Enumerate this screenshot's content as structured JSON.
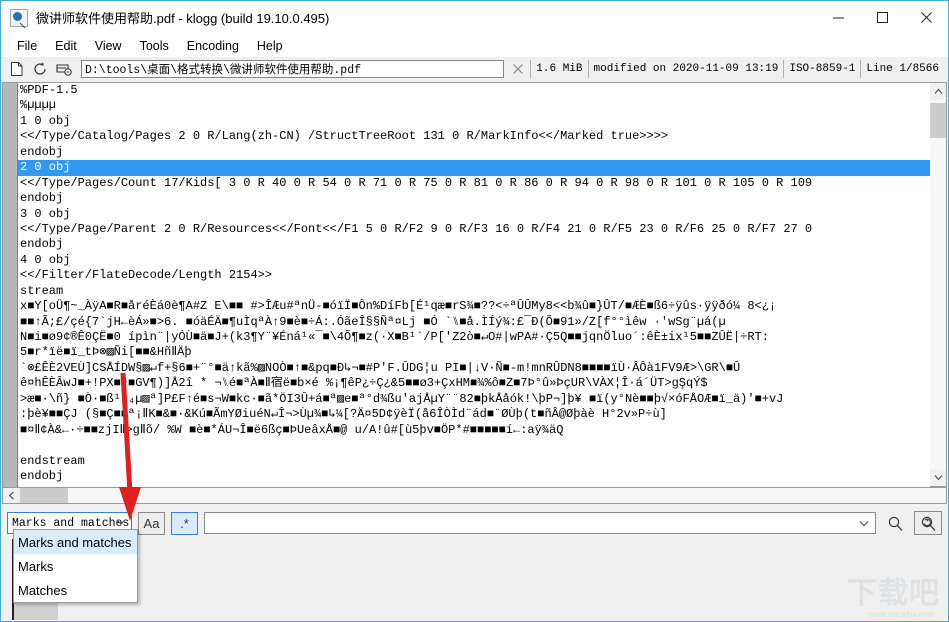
{
  "window": {
    "title": "微讲师软件使用帮助.pdf - klogg (build 19.10.0.495)",
    "icon": "klogg-app-icon",
    "minimize": "—",
    "maximize": "□",
    "close": "✕"
  },
  "menubar": {
    "items": [
      {
        "label": "File"
      },
      {
        "label": "Edit"
      },
      {
        "label": "View"
      },
      {
        "label": "Tools"
      },
      {
        "label": "Encoding"
      },
      {
        "label": "Help"
      }
    ]
  },
  "toolbar": {
    "icons": [
      {
        "name": "open-file-icon",
        "glyph": "document"
      },
      {
        "name": "reload-icon",
        "glyph": "refresh"
      },
      {
        "name": "follow-file-icon",
        "glyph": "follow"
      }
    ],
    "path": "D:\\tools\\桌面\\格式转换\\微讲师软件使用帮助.pdf",
    "close_icon": "✕",
    "status": [
      "1.6 MiB",
      "modified on 2020-11-09 13:19",
      "ISO-8859-1",
      "Line 1/8566"
    ]
  },
  "log": {
    "selected_index": 5,
    "lines": [
      "%PDF-1.5",
      "%µµµµ",
      "1 0 obj",
      "<</Type/Catalog/Pages 2 0 R/Lang(zh-CN) /StructTreeRoot 131 0 R/MarkInfo<</Marked true>>>>",
      "endobj",
      "2 0 obj",
      "<</Type/Pages/Count 17/Kids[ 3 0 R 40 0 R 54 0 R 71 0 R 75 0 R 81 0 R 86 0 R 94 0 R 98 0 R 101 0 R 105 0 R 109",
      "endobj",
      "3 0 obj",
      "<</Type/Page/Parent 2 0 R/Resources<</Font<</F1 5 0 R/F2 9 0 R/F3 16 0 R/F4 21 0 R/F5 23 0 R/F6 25 0 R/F7 27 0",
      "endobj",
      "4 0 obj",
      "<</Filter/FlateDecode/Length 2154>>",
      "stream",
      "x■Y[oÜ¶~_ÀÿA■R■åréÈá0è¶A#Z E\\■■ #>ÎÆu#ªnÜ-■óïÏ■Ôn%DíFb[É¹qæ■rS¾■??<÷ªÛÛMy8<<b¾û■}ÛT/■ÆÈ■ß6÷ÿûs·ÿÿðó¼ 8<¿¡",
      "■■↑Ã;£/çé{7`jH←èÁ»■>6. ■óäÉÄ■¶uÌqªÀ↑9■è■÷Á:.ÓãeÎ§§Ñª¤Lj ■Ó `⑊■å.ÌÍý¾:£¯Ð(Õ■91»/Z[f°°ìêw ·'wSg¨µá(µ",
      "N■i■ø9¢®Ê0ÇË■0 ípìn¨|yÓÙ■ä■J+(k3¶Y¨¥Éná¹«¯■\\4Õ¶■z(·X■B¹`/P['Z2ò■↵O#|wPA#·Ç5Q■■jqnÖluo´:êÈ±ix¹5■■ZÛË|÷RT:",
      "5■r*ïë■ï_tÞ⊗▨Ñi[■■&HñⅡÄþ",
      "`⊗£ÊÈ2VEÙ]CSÅÍDW§▨↵f+§6■+¨°■ä↑kã%▨NOÒ■↑■&pq■Ð↳¬■#P'F.ÛDG¦u PI■|↓V·Ñ■-m!mnRÛDN8■■■■ïÙ·ÂÔà1FV9Æ>\\GR\\■Û",
      "ê¤hÊÈÂwJ■+!PX■ª■GV¶)]Å2î * ¬⑊é■ªÀ■Ⅱ宿ë■b×é %¡¶êP¿÷Ç¿&5■■ø3+ÇxHM■¾%ô■Z■7Þ°û»ÞçUR\\VÀX¦Î·á´ÜT>gŞqÝ$",
      ">æ■·\\ñ} ■Ò·■ß¹⁄₄µ▨ª]P£F↑é■s¬W■kc·■ã*ÖI3Û+á■ª▨e■ª°d¾ßu'ajÅµY¨¨82■þkÅåók!\\þP¬]þ¥ ■ï(y°Nè■■þ√×óFÅOÆ■ï_ä)'■+vJ",
      ":þè¥■■ÇJ (§■Ç■■ª¡ⅡK■&■·&Kú■ÃmYØiuéN↵Î¬>Ùµ¾■↳¼[?Ä¤5D¢ÿèÏ(å6ÎÒÌd¨ád■¨ØÙþ(t■ñÂ@Øþàè H°2v»P÷ù]",
      "■¤Ⅱ¢À&←·÷■■zjIⅡ>gⅡõ/ %W ■è■*ÁU¬Î■ë6ßç■ÞUeâxÅ■@ u/A!û#[ù5þv■ÖP*#■■■■■í←:aÿ¾äQ",
      "",
      "endstream",
      "endobj"
    ]
  },
  "search": {
    "mode_selected": "Marks and matches",
    "mode_options": [
      "Marks and matches",
      "Marks",
      "Matches"
    ],
    "case_button": "Aa",
    "regex_button": ".*",
    "query_value": "",
    "query_placeholder": "",
    "search_icon": "magnifier-icon",
    "search_again_icon": "search-refresh-icon"
  },
  "annotation": {
    "arrow": "red-arrow-pointing-to-mode-dropdown",
    "color": "#e01f1f"
  },
  "watermark": {
    "text": "下载吧",
    "url": "www.xiazaiba.com"
  }
}
